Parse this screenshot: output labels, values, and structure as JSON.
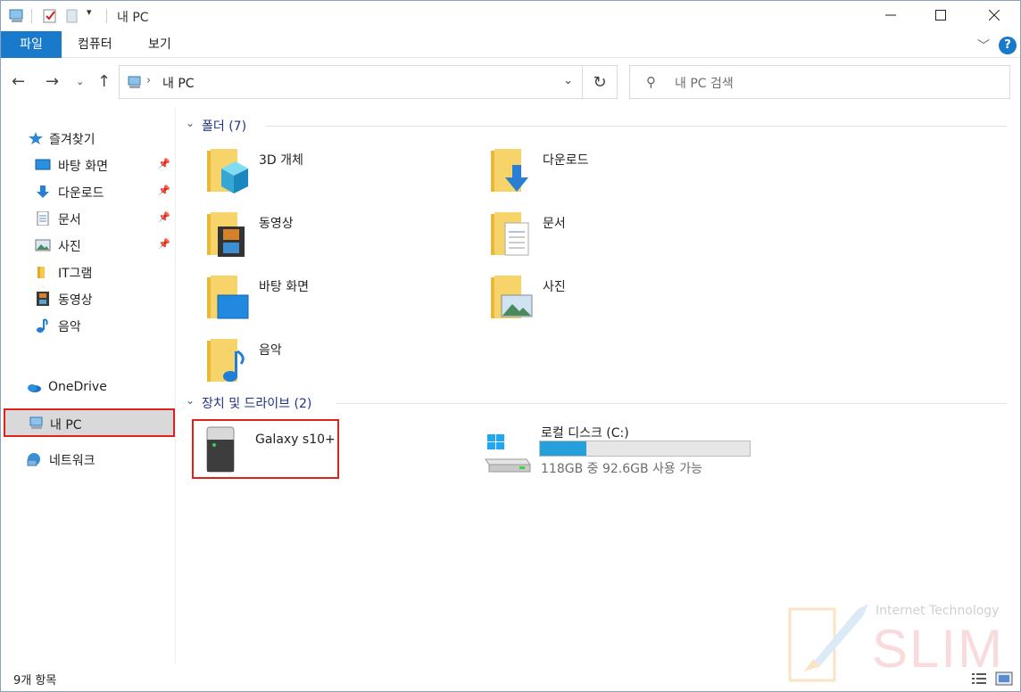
{
  "window": {
    "title": "내 PC"
  },
  "ribbon": {
    "tabs": [
      "파일",
      "컴퓨터",
      "보기"
    ],
    "help": "?"
  },
  "nav": {
    "address": "내 PC",
    "search_placeholder": "내 PC 검색"
  },
  "sidebar": {
    "quick_access": "즐겨찾기",
    "items": [
      {
        "label": "바탕 화면",
        "pinned": true
      },
      {
        "label": "다운로드",
        "pinned": true
      },
      {
        "label": "문서",
        "pinned": true
      },
      {
        "label": "사진",
        "pinned": true
      },
      {
        "label": "IT그램",
        "pinned": false
      },
      {
        "label": "동영상",
        "pinned": false
      },
      {
        "label": "음악",
        "pinned": false
      }
    ],
    "onedrive": "OneDrive",
    "this_pc": "내 PC",
    "network": "네트워크"
  },
  "content": {
    "folders_header": "폴더 (7)",
    "folders": [
      "3D 개체",
      "다운로드",
      "동영상",
      "문서",
      "바탕 화면",
      "사진",
      "음악"
    ],
    "devices_header": "장치 및 드라이브 (2)",
    "devices": {
      "galaxy": "Galaxy s10+",
      "local_disk": "로컬 디스크 (C:)",
      "local_disk_usage": "118GB 중 92.6GB 사용 가능",
      "used_fraction": 0.22
    }
  },
  "status": {
    "items": "9개 항목"
  },
  "watermark": {
    "line1": "Internet Technology",
    "line2": "SLIM"
  },
  "colors": {
    "accent": "#1979ca",
    "highlight": "#e0201c",
    "drive_fill": "#26a0da",
    "group_header": "#1e3287"
  }
}
